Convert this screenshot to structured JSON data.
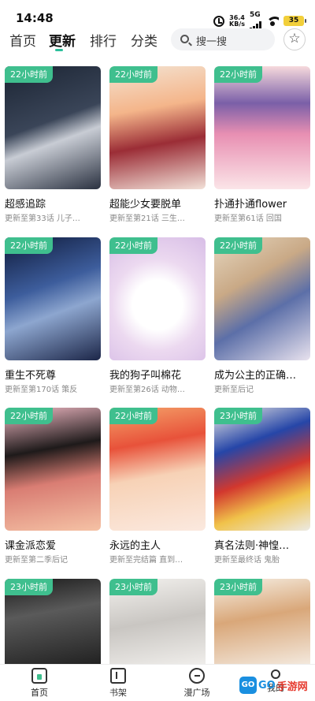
{
  "status": {
    "time": "14:48",
    "net_speed_top": "36.4",
    "net_speed_bottom": "KB/s",
    "network": "5G",
    "battery": "35"
  },
  "nav": {
    "tabs": [
      {
        "label": "首页"
      },
      {
        "label": "更新"
      },
      {
        "label": "排行"
      },
      {
        "label": "分类"
      }
    ],
    "search_placeholder": "搜一搜",
    "vip_icon": "star-icon"
  },
  "comics": [
    {
      "badge": "22小时前",
      "title": "超感追踪",
      "subtitle": "更新至第33话 儿子…"
    },
    {
      "badge": "22小时前",
      "title": "超能少女要脱单",
      "subtitle": "更新至第21话 三生…"
    },
    {
      "badge": "22小时前",
      "title": "扑通扑通flower",
      "subtitle": "更新至第61话 回国"
    },
    {
      "badge": "22小时前",
      "title": "重生不死尊",
      "subtitle": "更新至第170话 策反"
    },
    {
      "badge": "22小时前",
      "title": "我的狗子叫棉花",
      "subtitle": "更新至第26话 动物…"
    },
    {
      "badge": "22小时前",
      "title": "成为公主的正确…",
      "subtitle": "更新至后记"
    },
    {
      "badge": "22小时前",
      "title": "课金派恋爱",
      "subtitle": "更新至第二季后记"
    },
    {
      "badge": "22小时前",
      "title": "永远的主人",
      "subtitle": "更新至完结篇 直到…"
    },
    {
      "badge": "23小时前",
      "title": "真名法则·神惶…",
      "subtitle": "更新至最终话 鬼胎"
    },
    {
      "badge": "23小时前",
      "title": "",
      "subtitle": ""
    },
    {
      "badge": "23小时前",
      "title": "",
      "subtitle": ""
    },
    {
      "badge": "23小时前",
      "title": "",
      "subtitle": ""
    }
  ],
  "bottom_nav": [
    {
      "label": "首页"
    },
    {
      "label": "书架"
    },
    {
      "label": "漫广场"
    },
    {
      "label": "我的"
    }
  ],
  "watermark": {
    "logo": "GO",
    "text1": "GO",
    "text2": "手游网"
  },
  "colors": {
    "accent": "#2bbf9b",
    "badge": "#3fbf8e"
  }
}
